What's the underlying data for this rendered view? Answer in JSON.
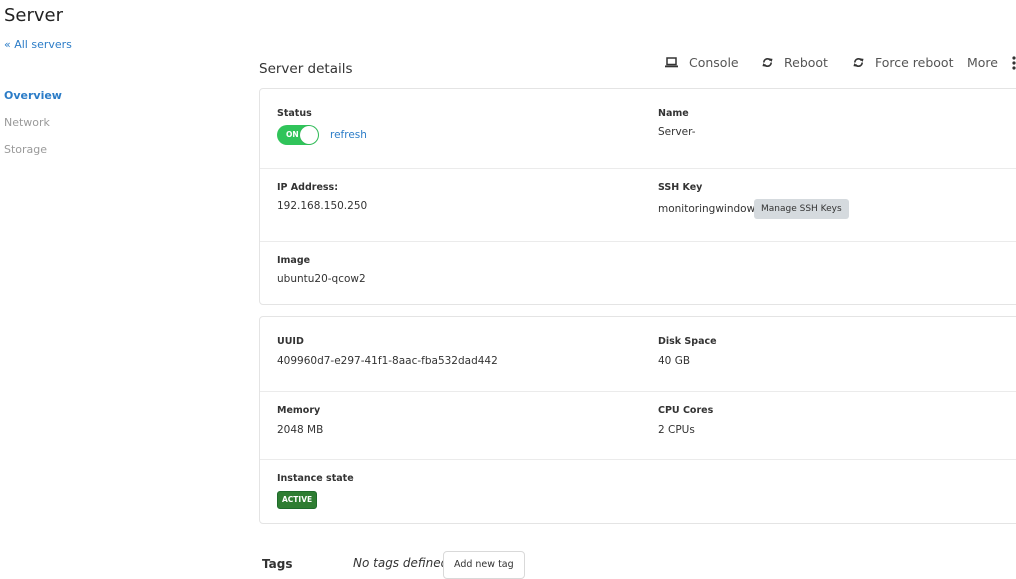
{
  "header": {
    "title": "Server",
    "back_link": "« All servers"
  },
  "sidebar": {
    "items": [
      {
        "label": "Overview",
        "active": true
      },
      {
        "label": "Network",
        "active": false
      },
      {
        "label": "Storage",
        "active": false
      }
    ]
  },
  "section": {
    "title": "Server details"
  },
  "actions": {
    "console": {
      "label": "Console",
      "icon": "laptop-icon"
    },
    "reboot": {
      "label": "Reboot",
      "icon": "refresh-icon"
    },
    "force_reboot": {
      "label": "Force reboot",
      "icon": "refresh-icon"
    },
    "more": {
      "label": "More",
      "icon": "kebab-icon"
    }
  },
  "details": {
    "status_label": "Status",
    "status_toggle": "ON",
    "refresh_label": "refresh",
    "name_label": "Name",
    "name_value": "Server-",
    "ip_label": "IP Address:",
    "ip_value": "192.168.150.250",
    "ssh_label": "SSH Key",
    "ssh_value": "monitoringwindows",
    "ssh_button": "Manage SSH Keys",
    "image_label": "Image",
    "image_value": "ubuntu20-qcow2"
  },
  "specs": {
    "uuid_label": "UUID",
    "uuid_value": "409960d7-e297-41f1-8aac-fba532dad442",
    "disk_label": "Disk Space",
    "disk_value": "40 GB",
    "memory_label": "Memory",
    "memory_value": "2048 MB",
    "cpu_label": "CPU Cores",
    "cpu_value": "2 CPUs",
    "state_label": "Instance state",
    "state_value": "ACTIVE"
  },
  "tags": {
    "title": "Tags",
    "empty_text": "No tags defined",
    "add_button": "Add new tag"
  },
  "colors": {
    "link": "#2b7cc7",
    "toggle_on": "#30c45a",
    "badge_active": "#2e7d32",
    "ssh_button_bg": "#d5dade"
  }
}
